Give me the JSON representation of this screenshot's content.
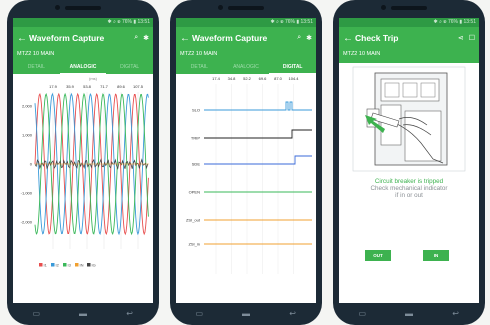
{
  "status": {
    "text": "✱ ⌕ ⦿ 76% ▮ 13:51"
  },
  "phones": [
    {
      "title": "Waveform Capture",
      "subtitle": "MTZ2 10 MAIN",
      "tabs": [
        "DETAIL",
        "ANALOGIC",
        "DIGITAL"
      ],
      "active_tab": 1
    },
    {
      "title": "Waveform Capture",
      "subtitle": "MTZ2 10 MAIN",
      "tabs": [
        "DETAIL",
        "ANALOGIC",
        "DIGITAL"
      ],
      "active_tab": 2
    },
    {
      "title": "Check Trip",
      "subtitle": "MTZ2 10 MAIN"
    }
  ],
  "analog": {
    "unit": "(ms)",
    "ticks": [
      "17.9",
      "35.9",
      "53.8",
      "71.7",
      "89.6",
      "107.5"
    ],
    "ylabels": [
      "2,000",
      "1,000",
      "0",
      "-1,000",
      "-2,000"
    ],
    "legend": [
      "I1",
      "I2",
      "I3",
      "IN",
      "IG"
    ]
  },
  "digital": {
    "ticks": [
      "17.4",
      "34.8",
      "52.2",
      "69.6",
      "87.0",
      "104.4"
    ],
    "rows": [
      "SLO",
      "TRIP",
      "SDE",
      "OPEN",
      "ZSI_out",
      "ZSI_in"
    ]
  },
  "check": {
    "status": "Circuit breaker is tripped",
    "line1": "Check mechanical indicator",
    "line2": "if in or out",
    "btn_out": "OUT",
    "btn_in": "IN"
  },
  "colors": {
    "accent": "#3db24f",
    "i1": "#e84e4e",
    "i2": "#3a9ad9",
    "i3": "#3ab85a",
    "in": "#f0a030",
    "ig": "#444444"
  },
  "icons": {
    "back": "arrow-left-icon",
    "search": "search-icon",
    "bluetooth": "bluetooth-icon",
    "share": "share-icon",
    "phone": "phone-icon"
  }
}
